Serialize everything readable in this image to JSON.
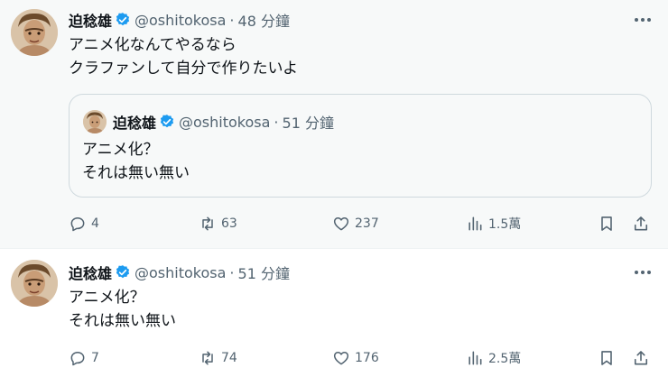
{
  "tweets": [
    {
      "author": {
        "name": "迫稔雄",
        "handle": "@oshitokosa",
        "verified": true
      },
      "time": "48 分鐘",
      "text_lines": [
        "アニメ化なんてやるなら",
        "クラファンして自分で作りたいよ"
      ],
      "quote": {
        "author": {
          "name": "迫稔雄",
          "handle": "@oshitokosa"
        },
        "time": "51 分鐘",
        "text_lines": [
          "アニメ化？",
          "それは無い無い"
        ]
      },
      "stats": {
        "replies": "4",
        "retweets": "63",
        "likes": "237",
        "views": "1.5萬"
      }
    },
    {
      "author": {
        "name": "迫稔雄",
        "handle": "@oshitokosa",
        "verified": true
      },
      "time": "51 分鐘",
      "text_lines": [
        "アニメ化？",
        "それは無い無い"
      ],
      "stats": {
        "replies": "7",
        "retweets": "74",
        "likes": "176",
        "views": "2.5萬"
      }
    }
  ],
  "separator": "·",
  "colors": {
    "verified": "#1d9bf0",
    "secondary_text": "#536471",
    "border": "#cfd9de",
    "highlight_bg": "#f7f9f9"
  }
}
